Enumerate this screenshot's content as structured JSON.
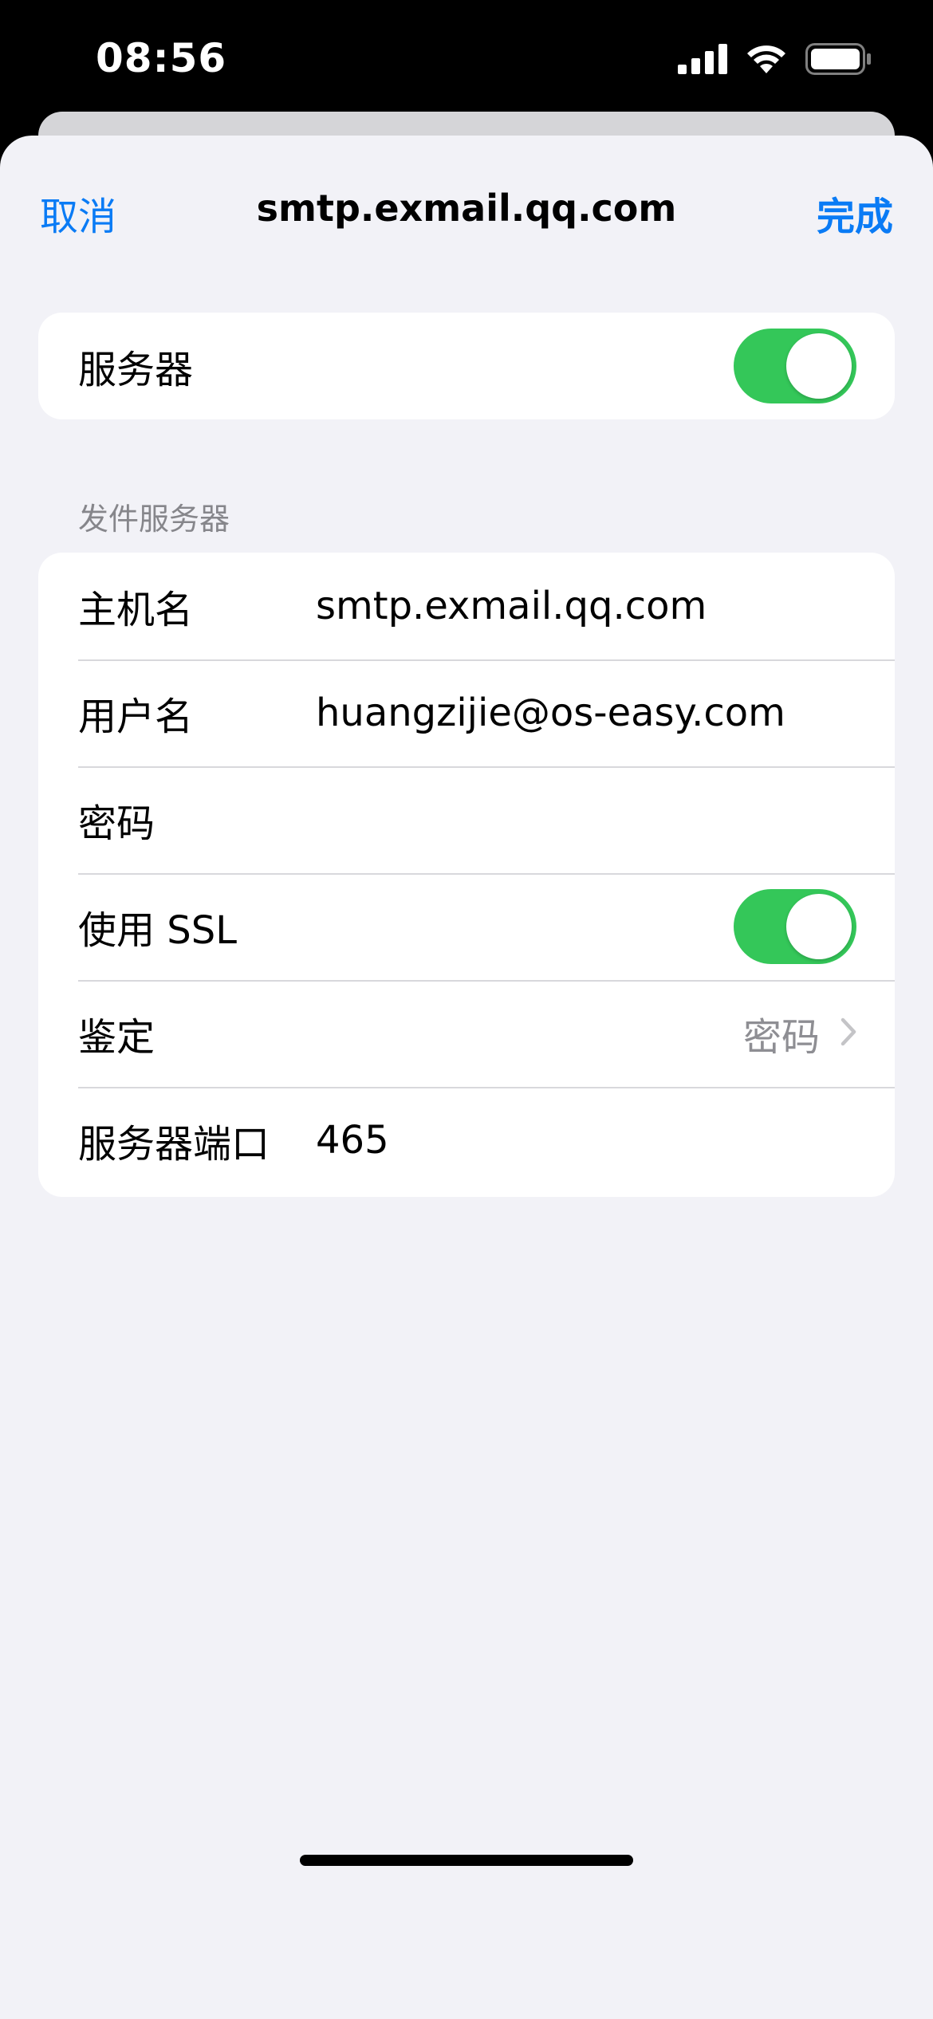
{
  "status_bar": {
    "time": "08:56",
    "icons": [
      "cellular-signal-icon",
      "wifi-icon",
      "battery-icon"
    ]
  },
  "nav": {
    "cancel_label": "取消",
    "title": "smtp.exmail.qq.com",
    "done_label": "完成"
  },
  "server_group": {
    "label": "服务器",
    "toggle_on": true
  },
  "outgoing": {
    "section_title": "发件服务器",
    "host": {
      "label": "主机名",
      "value": "smtp.exmail.qq.com"
    },
    "username": {
      "label": "用户名",
      "value": "huangzijie@os-easy.com"
    },
    "password": {
      "label": "密码",
      "value": ""
    },
    "ssl": {
      "label": "使用 SSL",
      "toggle_on": true
    },
    "auth": {
      "label": "鉴定",
      "value": "密码"
    },
    "port": {
      "label": "服务器端口",
      "value": "465"
    }
  },
  "colors": {
    "accent": "#0a7bf5",
    "toggle_on": "#34c759",
    "background": "#f2f2f7"
  }
}
